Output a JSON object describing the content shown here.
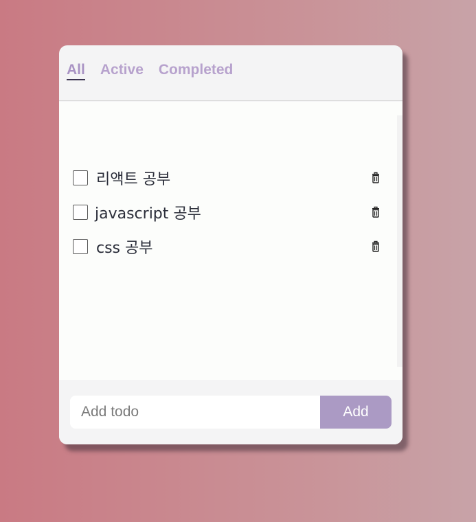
{
  "tabs": [
    {
      "label": "All",
      "active": true
    },
    {
      "label": "Active",
      "active": false
    },
    {
      "label": "Completed",
      "active": false
    }
  ],
  "todos": [
    {
      "text": "리액트 공부",
      "done": false,
      "icon": "trash-icon"
    },
    {
      "text": "javascript 공부",
      "done": false,
      "icon": "trash-icon"
    },
    {
      "text": "css 공부",
      "done": false,
      "icon": "trash-icon"
    }
  ],
  "form": {
    "placeholder": "Add todo",
    "value": "",
    "add_label": "Add"
  },
  "colors": {
    "accent": "#ab9ac4",
    "tab_text": "#b7a2cd",
    "tab_underline": "#3b3350",
    "background_start": "#c97a83",
    "background_end": "#c8a3a8"
  }
}
